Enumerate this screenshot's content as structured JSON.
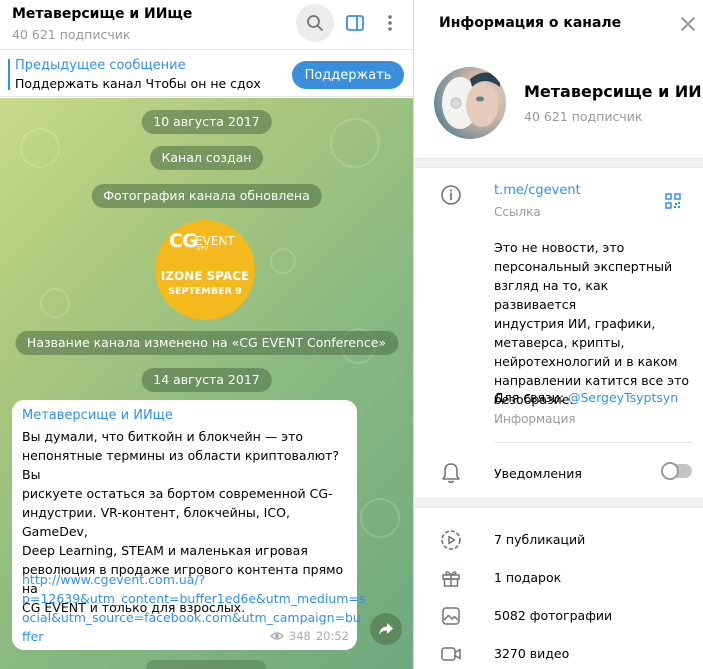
{
  "chat": {
    "title": "Метаверсище и ИИще",
    "subscribers": "40 621 подписчик",
    "icons": {
      "search": "search-icon",
      "sidebar": "sidebar-icon",
      "more": "more-vertical-icon"
    },
    "pinned": {
      "title": "Предыдущее сообщение",
      "text": "Поддержать канал  Чтобы он не сдох",
      "button": "Поддержать"
    },
    "service_messages": {
      "date1": "10 августа 2017",
      "created": "Канал создан",
      "photo_updated": "Фотография канала обновлена",
      "renamed": "Название канала изменено на «CG EVENT Conference»",
      "date2": "14 августа 2017"
    },
    "channel_photo": {
      "logo_mark": "CG",
      "logo_word": "EVENT",
      "logo_city": "KYIV",
      "line1": "IZONE SPACE",
      "line2": "SEPTEMBER 9"
    },
    "post": {
      "author": "Метаверсище и ИИще",
      "text": "Вы думали, что биткойн и блокчейн — это\nнепонятные термины из области криптовалют? Вы\nрискуете остаться за бортом современной CG-\nиндустрии. VR-контент, блокчейны, ICO, GameDev,\nDeep Learning, STEAM и маленькая игровая\nреволюция в продаже игрового контента прямо на\nCG EVENT и только для взрослых.",
      "link": "http://www.cgevent.com.ua/?\np=12639&utm_content=buffer1ed6e&utm_medium=s\nocial&utm_source=facebook.com&utm_campaign=bu\nffer",
      "views": "348",
      "time": "20:52"
    }
  },
  "info": {
    "title": "Информация о канале",
    "name": "Метаверсище и ИИще",
    "subscribers": "40 621 подписчик",
    "link": "t.me/cgevent",
    "link_caption": "Ссылка",
    "description": "Это не новости, это\nперсональный экспертный\nвзгляд на то, как развивается\nиндустрия ИИ, графики,\nметаверса, крипты,\nнейротехнологий и в каком\nнаправлении катится все это\nбезобразие.",
    "contact_prefix": "Для связи: ",
    "contact_handle": "@SergeyTsyptsyn",
    "description_caption": "Информация",
    "notifications_label": "Уведомления",
    "notifications_on": false,
    "media": [
      {
        "icon": "publications-icon",
        "label": "7 публикаций"
      },
      {
        "icon": "gift-icon",
        "label": "1 подарок"
      },
      {
        "icon": "photo-icon",
        "label": "5082 фотографии"
      },
      {
        "icon": "video-icon",
        "label": "3270 видео"
      }
    ]
  },
  "colors": {
    "accent": "#3390ec",
    "button": "#3a8fdc",
    "wallpaper": "#9fc27e",
    "photo_bg": "#f4b91d"
  }
}
